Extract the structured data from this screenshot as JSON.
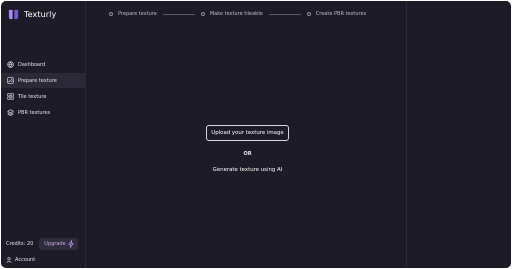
{
  "brand": {
    "name": "Texturly",
    "logo_color": "#a78bfa"
  },
  "stepper": {
    "steps": [
      {
        "label": "Prepare texture"
      },
      {
        "label": "Make texture tileable"
      },
      {
        "label": "Create PBR textures"
      }
    ]
  },
  "sidebar": {
    "items": [
      {
        "label": "Dashboard",
        "icon": "globe-icon"
      },
      {
        "label": "Prepare texture",
        "icon": "image-icon",
        "active": true
      },
      {
        "label": "Tile texture",
        "icon": "tiles-icon"
      },
      {
        "label": "PBR textures",
        "icon": "layers-icon"
      }
    ],
    "credits_label": "Credits: 20",
    "upgrade_label": "Upgrade",
    "account_label": "Account"
  },
  "main": {
    "upload_label": "Upload your texture image",
    "or_label": "OR",
    "generate_label": "Generate texture using AI"
  },
  "colors": {
    "background": "#1d1b27",
    "active_nav": "#2b2937",
    "accent": "#c7a7ef"
  }
}
